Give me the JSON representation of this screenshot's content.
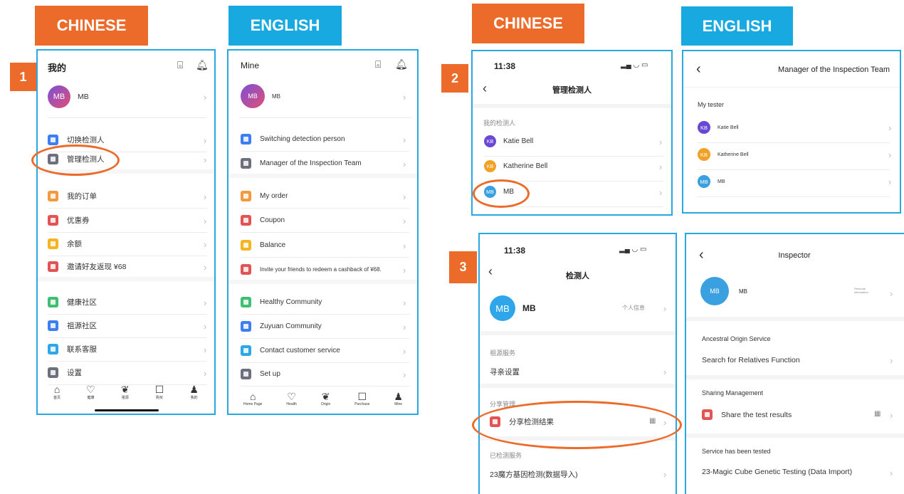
{
  "labels": {
    "cn1": "CHINESE",
    "en1": "ENGLISH",
    "cn2": "CHINESE",
    "en2": "ENGLISH"
  },
  "steps": {
    "s1": "1",
    "s2": "2",
    "s3": "3"
  },
  "panel1": {
    "title": "我的",
    "user": "MB",
    "avatar": "MB",
    "items": [
      {
        "label": "切换检测人",
        "color": "#3d7ff0"
      },
      {
        "label": "管理检测人",
        "color": "#6d6f7d"
      },
      {
        "label": "我的订单",
        "color": "#f19a3e"
      },
      {
        "label": "优惠券",
        "color": "#e25454"
      },
      {
        "label": "余额",
        "color": "#f5b521"
      },
      {
        "label": "邀请好友返现 ¥68",
        "color": "#e25454"
      },
      {
        "label": "健康社区",
        "color": "#3fbf72"
      },
      {
        "label": "祖源社区",
        "color": "#3d7ff0"
      },
      {
        "label": "联系客服",
        "color": "#2ea7e8"
      },
      {
        "label": "设置",
        "color": "#6d6f7d"
      }
    ],
    "tabs": [
      "首页",
      "健康",
      "祖源",
      "购买",
      "我的"
    ]
  },
  "panel2": {
    "title": "Mine",
    "user": "MB",
    "avatar": "MB",
    "items": [
      {
        "label": "Switching detection person",
        "color": "#3d7ff0"
      },
      {
        "label": "Manager of the Inspection Team",
        "color": "#6d6f7d"
      },
      {
        "label": "My order",
        "color": "#f19a3e"
      },
      {
        "label": "Coupon",
        "color": "#e25454"
      },
      {
        "label": "Balance",
        "color": "#f5b521"
      },
      {
        "label": "Invite your friends to redeem a cashback of ¥68.",
        "color": "#e25454"
      },
      {
        "label": "Healthy Community",
        "color": "#3fbf72"
      },
      {
        "label": "Zuyuan Community",
        "color": "#3d7ff0"
      },
      {
        "label": "Contact customer service",
        "color": "#2ea7e8"
      },
      {
        "label": "Set up",
        "color": "#6d6f7d"
      }
    ],
    "tabs": [
      "Home Page",
      "Health",
      "Origin",
      "Purchase",
      "Mine"
    ]
  },
  "panel3": {
    "time": "11:38",
    "title": "管理检测人",
    "section": "我的检测人",
    "people": [
      {
        "initials": "KB",
        "name": "Katie Bell",
        "color": "#6b47d6"
      },
      {
        "initials": "KB",
        "name": "Katherine Bell",
        "color": "#f0a126"
      },
      {
        "initials": "MB",
        "name": "MB",
        "color": "#3aa0e0"
      }
    ]
  },
  "panel4": {
    "title": "Manager of the Inspection Team",
    "section": "My tester",
    "people": [
      {
        "initials": "KB",
        "name": "Katie Bell",
        "color": "#6b47d6"
      },
      {
        "initials": "KB",
        "name": "Katherine Bell",
        "color": "#f0a126"
      },
      {
        "initials": "MB",
        "name": "MB",
        "color": "#3aa0e0"
      }
    ]
  },
  "panel5": {
    "time": "11:38",
    "title": "检测人",
    "user": "MB",
    "avatar": "MB",
    "info": "个人信息",
    "sec1": "祖源服务",
    "item1": "寻亲设置",
    "sec2": "分享管理",
    "item2": "分享检测结果",
    "sec3": "已检测服务",
    "item3": "23魔方基因检测(数据导入)"
  },
  "panel6": {
    "title": "Inspector",
    "user": "MB",
    "avatar": "MB",
    "info": "Personal information",
    "sec1": "Ancestral Origin Service",
    "item1": "Search for Relatives Function",
    "sec2": "Sharing Management",
    "item2": "Share the test results",
    "sec3": "Service has been tested",
    "item3": "23-Magic Cube Genetic Testing (Data Import)"
  }
}
